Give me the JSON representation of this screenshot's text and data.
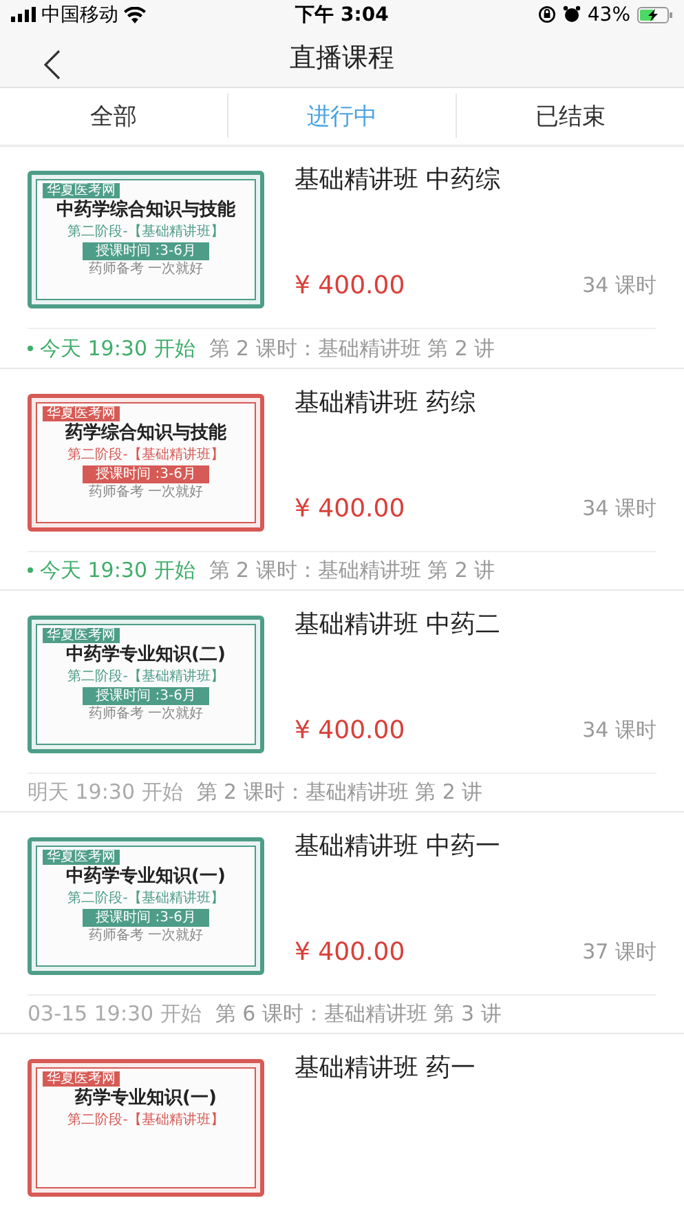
{
  "status_bar": {
    "carrier": "中国移动",
    "time": "下午 3:04",
    "battery": "43%"
  },
  "nav": {
    "title": "直播课程"
  },
  "tabs": [
    {
      "label": "全部",
      "selected": false
    },
    {
      "label": "进行中",
      "selected": true
    },
    {
      "label": "已结束",
      "selected": false
    }
  ],
  "courses": [
    {
      "banner": {
        "color": "#4e9d88",
        "logo": "华夏医考网",
        "title": "中药学综合知识与技能",
        "subtitle": "第二阶段-【基础精讲班】",
        "period": "授课时间 :3-6月",
        "footer": "药师备考 一次就好"
      },
      "title": "基础精讲班 中药综",
      "price": "¥ 400.00",
      "lessons": "34 课时",
      "schedule": {
        "live": true,
        "start": "今天 19:30 开始",
        "lesson": "第 2 课时：基础精讲班 第 2 讲"
      }
    },
    {
      "banner": {
        "color": "#d65a55",
        "logo": "华夏医考网",
        "title": "药学综合知识与技能",
        "subtitle": "第二阶段-【基础精讲班】",
        "period": "授课时间 :3-6月",
        "footer": "药师备考 一次就好"
      },
      "title": "基础精讲班 药综",
      "price": "¥ 400.00",
      "lessons": "34 课时",
      "schedule": {
        "live": true,
        "start": "今天 19:30 开始",
        "lesson": "第 2 课时：基础精讲班 第 2 讲"
      }
    },
    {
      "banner": {
        "color": "#4e9d88",
        "logo": "华夏医考网",
        "title": "中药学专业知识(二)",
        "subtitle": "第二阶段-【基础精讲班】",
        "period": "授课时间 :3-6月",
        "footer": "药师备考 一次就好"
      },
      "title": "基础精讲班 中药二",
      "price": "¥ 400.00",
      "lessons": "34 课时",
      "schedule": {
        "live": false,
        "start": "明天 19:30 开始",
        "lesson": "第 2 课时：基础精讲班 第 2 讲"
      }
    },
    {
      "banner": {
        "color": "#4e9d88",
        "logo": "华夏医考网",
        "title": "中药学专业知识(一)",
        "subtitle": "第二阶段-【基础精讲班】",
        "period": "授课时间 :3-6月",
        "footer": "药师备考 一次就好"
      },
      "title": "基础精讲班 中药一",
      "price": "¥ 400.00",
      "lessons": "37 课时",
      "schedule": {
        "live": false,
        "start": "03-15 19:30 开始",
        "lesson": "第 6 课时：基础精讲班 第 3 讲"
      }
    },
    {
      "banner": {
        "color": "#d65a55",
        "logo": "华夏医考网",
        "title": "药学专业知识(一)",
        "subtitle": "第二阶段-【基础精讲班】"
      },
      "title": "基础精讲班 药一"
    }
  ]
}
